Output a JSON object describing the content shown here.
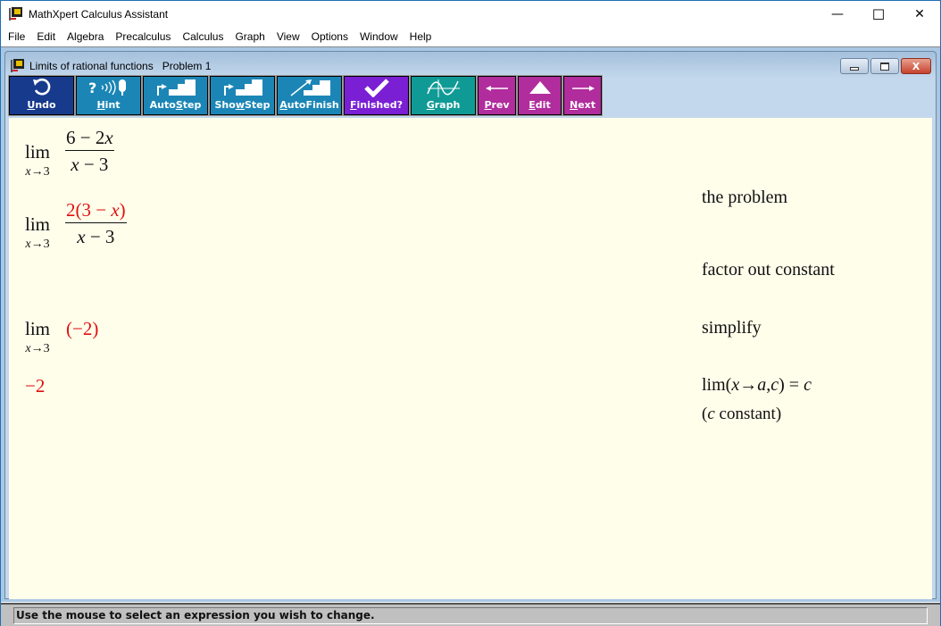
{
  "window": {
    "title": "MathXpert Calculus Assistant",
    "minimize_glyph": "—",
    "maximize_glyph": "☐",
    "close_glyph": "✕"
  },
  "menu": [
    "File",
    "Edit",
    "Algebra",
    "Precalculus",
    "Calculus",
    "Graph",
    "View",
    "Options",
    "Window",
    "Help"
  ],
  "child_window": {
    "title": "Limits of rational functions   Problem 1",
    "close_glyph": "X"
  },
  "toolbar": {
    "undo": {
      "pre": "",
      "key": "U",
      "post": "ndo"
    },
    "hint": {
      "pre": "",
      "key": "H",
      "post": "int",
      "icon_text": "?·)))"
    },
    "autostep": {
      "pre": "Auto",
      "key": "S",
      "post": "tep"
    },
    "showstep": {
      "pre": "Sho",
      "key": "w",
      "post": "Step"
    },
    "autofinish": {
      "pre": "",
      "key": "A",
      "post": "utoFinish"
    },
    "finished": {
      "pre": "",
      "key": "F",
      "post": "inished?",
      "icon_text": "✔"
    },
    "graph": {
      "pre": "",
      "key": "G",
      "post": "raph"
    },
    "prev": {
      "pre": "",
      "key": "P",
      "post": "rev",
      "icon_text": "⟵"
    },
    "edit": {
      "pre": "",
      "key": "E",
      "post": "dit",
      "icon_text": "▲"
    },
    "next": {
      "pre": "",
      "key": "N",
      "post": "ext",
      "icon_text": "⟶"
    }
  },
  "steps": [
    {
      "lim": "lim",
      "sub_var": "x",
      "sub_arrow": "→",
      "sub_val": "3",
      "numerator": {
        "a": "6",
        "op": " − ",
        "b": "2",
        "var": "x"
      },
      "denominator": {
        "var": "x",
        "op": " − ",
        "val": "3"
      },
      "justification": "the problem"
    },
    {
      "lim": "lim",
      "sub_var": "x",
      "sub_arrow": "→",
      "sub_val": "3",
      "numerator": {
        "pre": "2(3",
        "op": " − ",
        "var": "x",
        "post": ")"
      },
      "denominator": {
        "var": "x",
        "op": " − ",
        "val": "3"
      },
      "justification": "factor out constant"
    },
    {
      "lim": "lim",
      "sub_var": "x",
      "sub_arrow": "→",
      "sub_val": "3",
      "expr": "(−2)",
      "justification": "simplify"
    },
    {
      "expr": "−2",
      "justification_line1": {
        "lim": "lim(",
        "x": "x",
        "arrow": "→",
        "a": "a",
        "comma": ",",
        "c": "c",
        "close": ") = ",
        "c2": "c"
      },
      "justification_line2": {
        "open": "(",
        "c": "c",
        "rest": " constant)"
      }
    }
  ],
  "status": "Use the mouse to select an expression you wish to change."
}
